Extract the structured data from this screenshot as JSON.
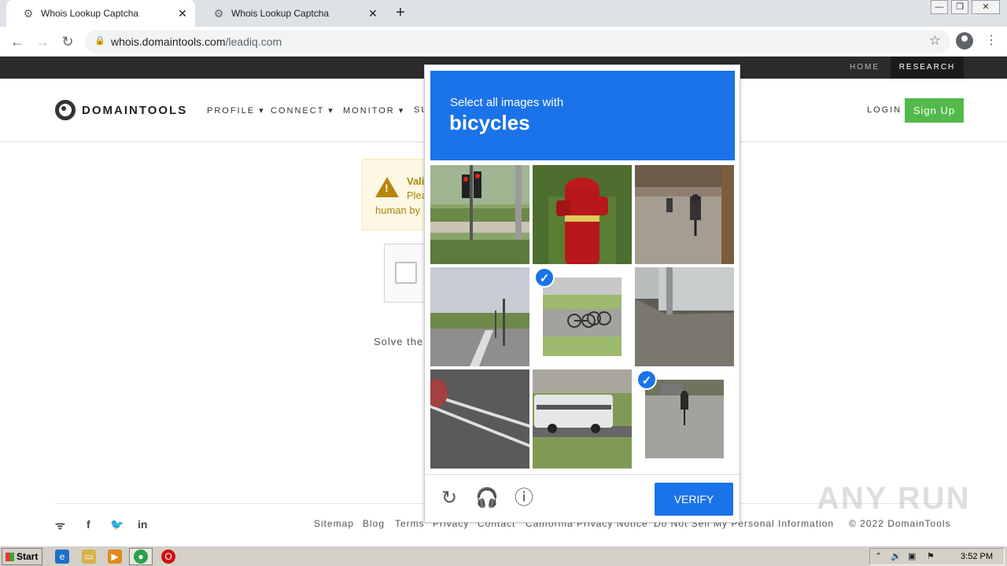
{
  "browser": {
    "tabs": [
      {
        "title": "Whois Lookup Captcha",
        "active": true
      },
      {
        "title": "Whois Lookup Captcha",
        "active": false
      }
    ],
    "url_domain": "whois.domaintools.com",
    "url_path": "/leadiq.com"
  },
  "site": {
    "topbar": {
      "home": "HOME",
      "research": "RESEARCH"
    },
    "logo": "DOMAINTOOLS",
    "nav": [
      "PROFILE ▾",
      "CONNECT ▾",
      "MONITOR ▾",
      "SU"
    ],
    "login": "LOGIN",
    "signup": "Sign Up",
    "alert": {
      "title": "Vali",
      "line2": "Plea",
      "line3": "human by"
    },
    "solve_text": "Solve the",
    "footer": {
      "links": [
        "Sitemap",
        "Blog",
        "Terms",
        "Privacy",
        "Contact",
        "California Privacy Notice",
        "Do Not Sell My Personal Information"
      ],
      "copyright": "© 2022 DomainTools"
    }
  },
  "captcha": {
    "prompt": "Select all images with",
    "target": "bicycles",
    "verify": "VERIFY",
    "selected_tiles": [
      5,
      9
    ]
  },
  "watermark": "ANY RUN",
  "taskbar": {
    "start": "Start",
    "time": "3:52 PM"
  },
  "colors": {
    "accent": "#1a73e8",
    "signup": "#53b94a",
    "warning": "#b8860b"
  }
}
